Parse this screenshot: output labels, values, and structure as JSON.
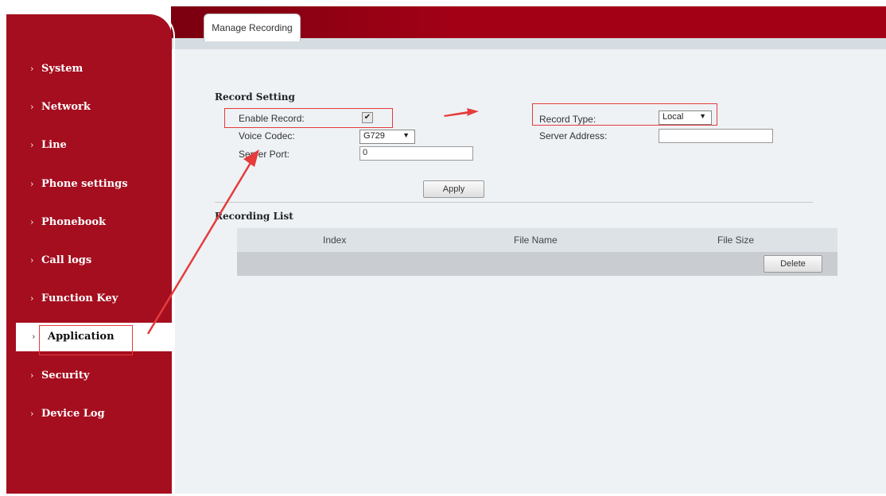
{
  "tab": {
    "label": "Manage Recording"
  },
  "sidebar": {
    "items": [
      {
        "label": "System"
      },
      {
        "label": "Network"
      },
      {
        "label": "Line"
      },
      {
        "label": "Phone settings"
      },
      {
        "label": "Phonebook"
      },
      {
        "label": "Call logs"
      },
      {
        "label": "Function Key"
      },
      {
        "label": "Application",
        "active": true
      },
      {
        "label": "Security"
      },
      {
        "label": "Device Log"
      }
    ],
    "chevron": "›"
  },
  "record_setting": {
    "title": "Record Setting",
    "enable_record_label": "Enable Record:",
    "enable_record_checked": true,
    "voice_codec_label": "Voice Codec:",
    "voice_codec_value": "G729",
    "server_port_label": "Server Port:",
    "server_port_value": "0",
    "record_type_label": "Record Type:",
    "record_type_value": "Local",
    "server_address_label": "Server Address:",
    "server_address_value": "",
    "apply_label": "Apply"
  },
  "recording_list": {
    "title": "Recording List",
    "columns": [
      "Index",
      "File Name",
      "File Size"
    ],
    "delete_label": "Delete"
  },
  "annotations": {
    "color": "#e53b3b"
  }
}
